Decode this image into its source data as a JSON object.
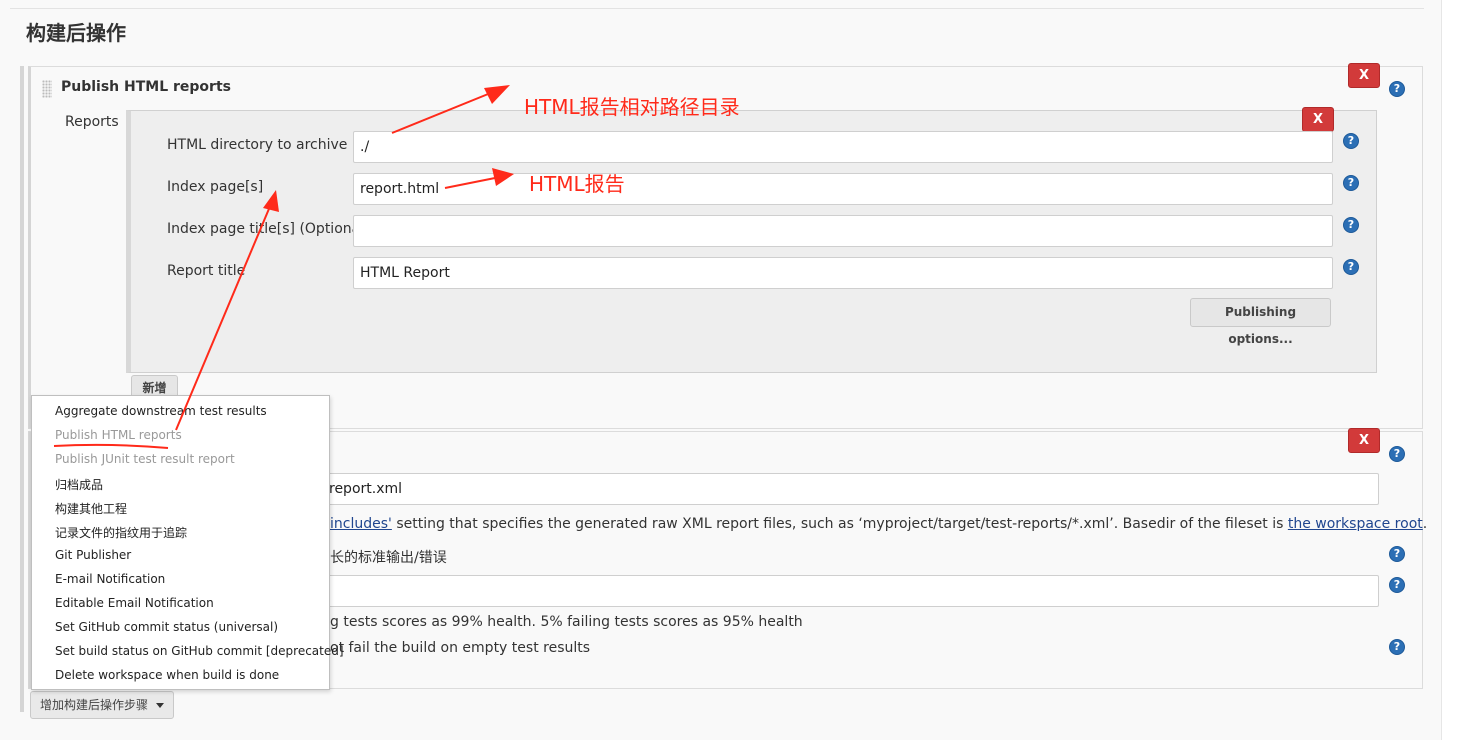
{
  "section": {
    "title": "构建后操作"
  },
  "publish_block": {
    "title": "Publish HTML reports",
    "reports_label": "Reports",
    "close_label": "X",
    "fields": {
      "dir_label": "HTML directory to archive",
      "dir_value": "./",
      "index_label": "Index page[s]",
      "index_value": "report.html",
      "titles_label": "Index page title[s] (Optional)",
      "titles_value": "",
      "report_title_label": "Report title",
      "report_title_value": "HTML Report"
    },
    "publishing_options": "Publishing options...",
    "add_button": "新增",
    "help": "?"
  },
  "junit_block": {
    "close_label": "X",
    "xml_value": "report.xml",
    "desc_link1": "includes'",
    "desc_middle": " setting that specifies the generated raw XML report files, such as ‘myproject/target/test-reports/*.xml’. Basedir of the fileset is ",
    "desc_link2": "the workspace root",
    "desc_end": ".",
    "stdout_text": "长的标准输出/错误",
    "health_text": "g tests scores as 99% health. 5% failing tests scores as 95% health",
    "empty_text": "ot fail the build on empty test results",
    "help": "?"
  },
  "menu": {
    "items": [
      "Aggregate downstream test results",
      "Publish HTML reports",
      "Publish JUnit test result report",
      "归档成品",
      "构建其他工程",
      "记录文件的指纹用于追踪",
      "Git Publisher",
      "E-mail Notification",
      "Editable Email Notification",
      "Set GitHub commit status (universal)",
      "Set build status on GitHub commit [deprecated]",
      "Delete workspace when build is done"
    ]
  },
  "add_step_button": "增加构建后操作步骤",
  "annotations": {
    "dir_note": "HTML报告相对路径目录",
    "index_note": "HTML报告"
  },
  "colors": {
    "annotation": "#ff2a1a",
    "close_button": "#d23a3a",
    "help_icon": "#2c6fb5",
    "link": "#20468f"
  }
}
